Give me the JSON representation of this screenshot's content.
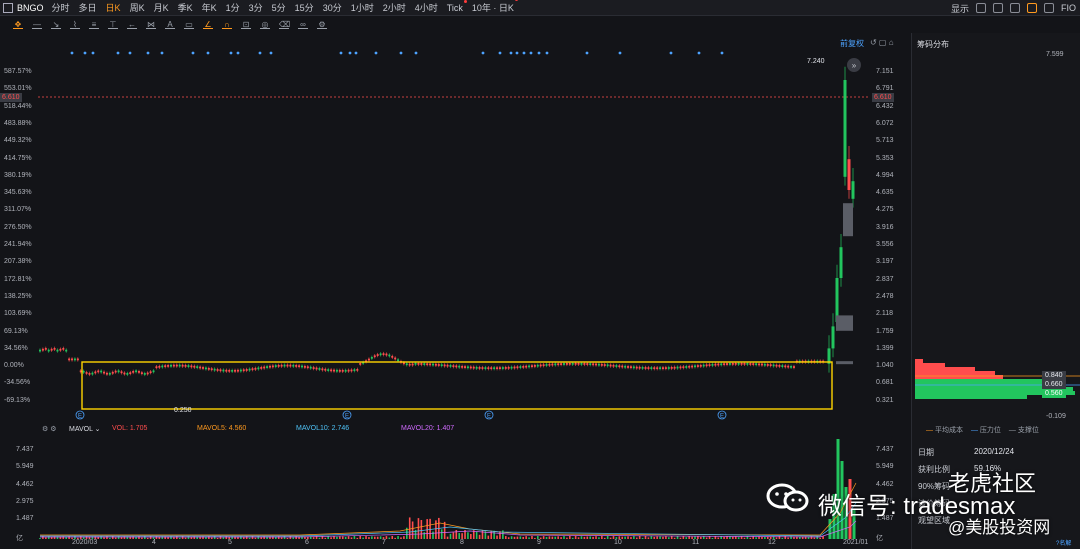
{
  "topbar": {
    "symbol": "BNGO",
    "periods": [
      {
        "label": "分时",
        "active": false,
        "dot": false
      },
      {
        "label": "多日",
        "active": false,
        "dot": false
      },
      {
        "label": "日K",
        "active": true,
        "dot": false
      },
      {
        "label": "周K",
        "active": false,
        "dot": false
      },
      {
        "label": "月K",
        "active": false,
        "dot": false
      },
      {
        "label": "季K",
        "active": false,
        "dot": false
      },
      {
        "label": "年K",
        "active": false,
        "dot": false
      },
      {
        "label": "1分",
        "active": false,
        "dot": false
      },
      {
        "label": "3分",
        "active": false,
        "dot": false
      },
      {
        "label": "5分",
        "active": false,
        "dot": false
      },
      {
        "label": "15分",
        "active": false,
        "dot": false
      },
      {
        "label": "30分",
        "active": false,
        "dot": false
      },
      {
        "label": "1小时",
        "active": false,
        "dot": false
      },
      {
        "label": "2小时",
        "active": false,
        "dot": false
      },
      {
        "label": "4小时",
        "active": false,
        "dot": false
      },
      {
        "label": "Tick",
        "active": false,
        "dot": true
      },
      {
        "label": "10年 · 日K",
        "active": false,
        "dot": true
      }
    ],
    "display_label": "显示",
    "fq_label": "FIO",
    "icons": [
      "gear-icon",
      "camera-icon",
      "pen-icon",
      "layout-icon",
      "window-icon"
    ]
  },
  "main": {
    "fq_button": "前复权",
    "price_line": "6.610",
    "high_label": "7.240",
    "low_label": "0.250",
    "left_axis": [
      "587.57%",
      "553.01%",
      "518.44%",
      "483.88%",
      "449.32%",
      "414.75%",
      "380.19%",
      "345.63%",
      "311.07%",
      "276.50%",
      "241.94%",
      "207.38%",
      "172.81%",
      "138.25%",
      "103.69%",
      "69.13%",
      "34.56%",
      "0.00%",
      "-34.56%",
      "-69.13%"
    ],
    "right_axis": [
      "7.151",
      "6.791",
      "6.432",
      "6.072",
      "5.713",
      "5.353",
      "4.994",
      "4.635",
      "4.275",
      "3.916",
      "3.556",
      "3.197",
      "2.837",
      "2.478",
      "2.118",
      "1.759",
      "1.399",
      "1.040",
      "0.681",
      "0.321"
    ],
    "e_markers": [
      "E",
      "E",
      "E",
      "E"
    ]
  },
  "volume": {
    "indicator": "MAVOL",
    "vol": "VOL: 1.705",
    "mavol5": "MAVOL5: 4.560",
    "mavol10": "MAVOL10: 2.746",
    "mavol20": "MAVOL20: 1.407",
    "left_axis": [
      "7.437",
      "5.949",
      "4.462",
      "2.975",
      "1.487",
      "亿"
    ],
    "right_axis": [
      "7.437",
      "5.949",
      "4.462",
      "2.975",
      "1.487",
      "亿"
    ],
    "x_labels": [
      "2020/03",
      "4",
      "5",
      "6",
      "7",
      "8",
      "9",
      "10",
      "11",
      "12",
      "2021/01"
    ]
  },
  "chips": {
    "title": "筹码分布",
    "top_value": "7.599",
    "bottom_value": "-0.109",
    "levels": [
      "0.840",
      "0.660",
      "0.560"
    ],
    "legend": [
      "平均成本",
      "压力位",
      "支撑位"
    ],
    "date_label": "日期",
    "date_value": "2020/12/24",
    "profit_label": "获利比例",
    "profit_value": "59.16%",
    "row3_label": "90%筹码",
    "row4_label": "该价筹码",
    "row5_label": "观望区域",
    "explain": "?名解"
  },
  "watermark": {
    "wechat": "微信号: tradesmax",
    "community": "老虎社区",
    "site": "@美股投资网"
  },
  "colors": {
    "up": "#ff4d4d",
    "down": "#22c55e",
    "accent": "#ff9a1f",
    "highlight_box": "#ffd400",
    "mavol5": "#ff9a1f",
    "mavol10": "#4fc3f7",
    "mavol20": "#d06bff"
  }
}
